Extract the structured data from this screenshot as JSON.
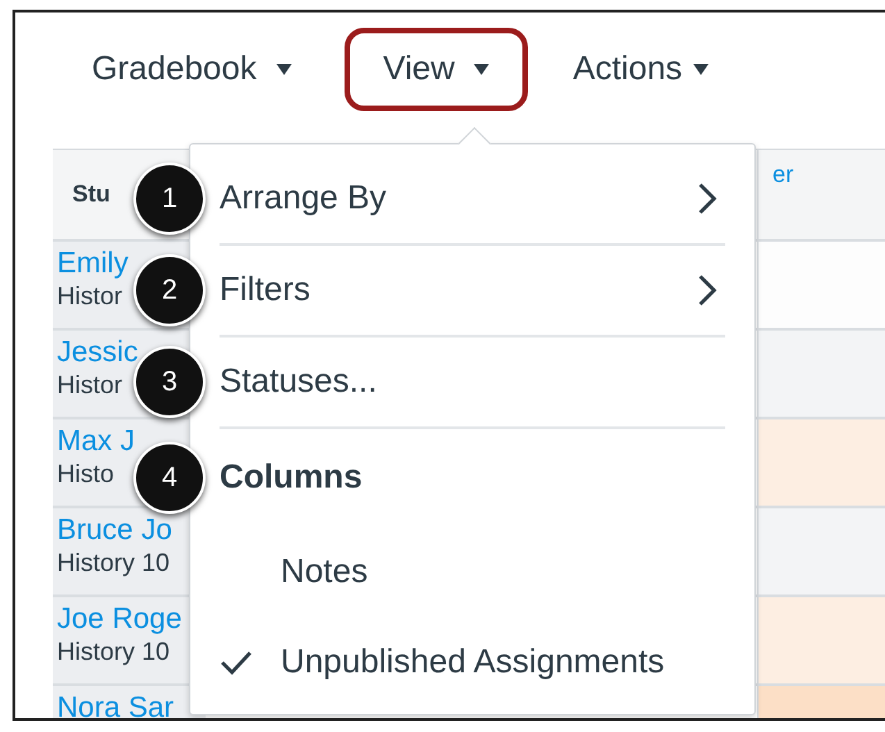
{
  "toolbar": [
    {
      "label": "Gradebook",
      "highlighted": false
    },
    {
      "label": "View",
      "highlighted": true
    },
    {
      "label": "Actions",
      "highlighted": false
    }
  ],
  "table": {
    "columns": [
      {
        "label": "Stu",
        "kind": "text"
      },
      {
        "label": "er",
        "kind": "link"
      }
    ],
    "rows": [
      {
        "name": "Emily",
        "section": "Histor",
        "color": "#fdfdfd"
      },
      {
        "name": "Jessic",
        "section": "Histor",
        "color": "#f3f4f6"
      },
      {
        "name": "Max J",
        "section": "Histo",
        "color": "#fdeee2"
      },
      {
        "name": "Bruce Jo",
        "section": "History 10",
        "color": "#f3f4f6"
      },
      {
        "name": "Joe Roge",
        "section": "History 10",
        "color": "#fdeee2"
      },
      {
        "name": "Nora Sar",
        "color": "#fcdfc6"
      }
    ]
  },
  "menu": {
    "items": [
      {
        "kind": "submenu",
        "label": "Arrange By",
        "callout": "1"
      },
      {
        "kind": "submenu",
        "label": "Filters",
        "callout": "2"
      },
      {
        "kind": "action",
        "label": "Statuses...",
        "callout": "3"
      },
      {
        "kind": "heading",
        "label": "Columns",
        "callout": "4"
      },
      {
        "kind": "option",
        "label": "Notes",
        "checked": false
      },
      {
        "kind": "option",
        "label": "Unpublished Assignments",
        "checked": true
      }
    ]
  }
}
